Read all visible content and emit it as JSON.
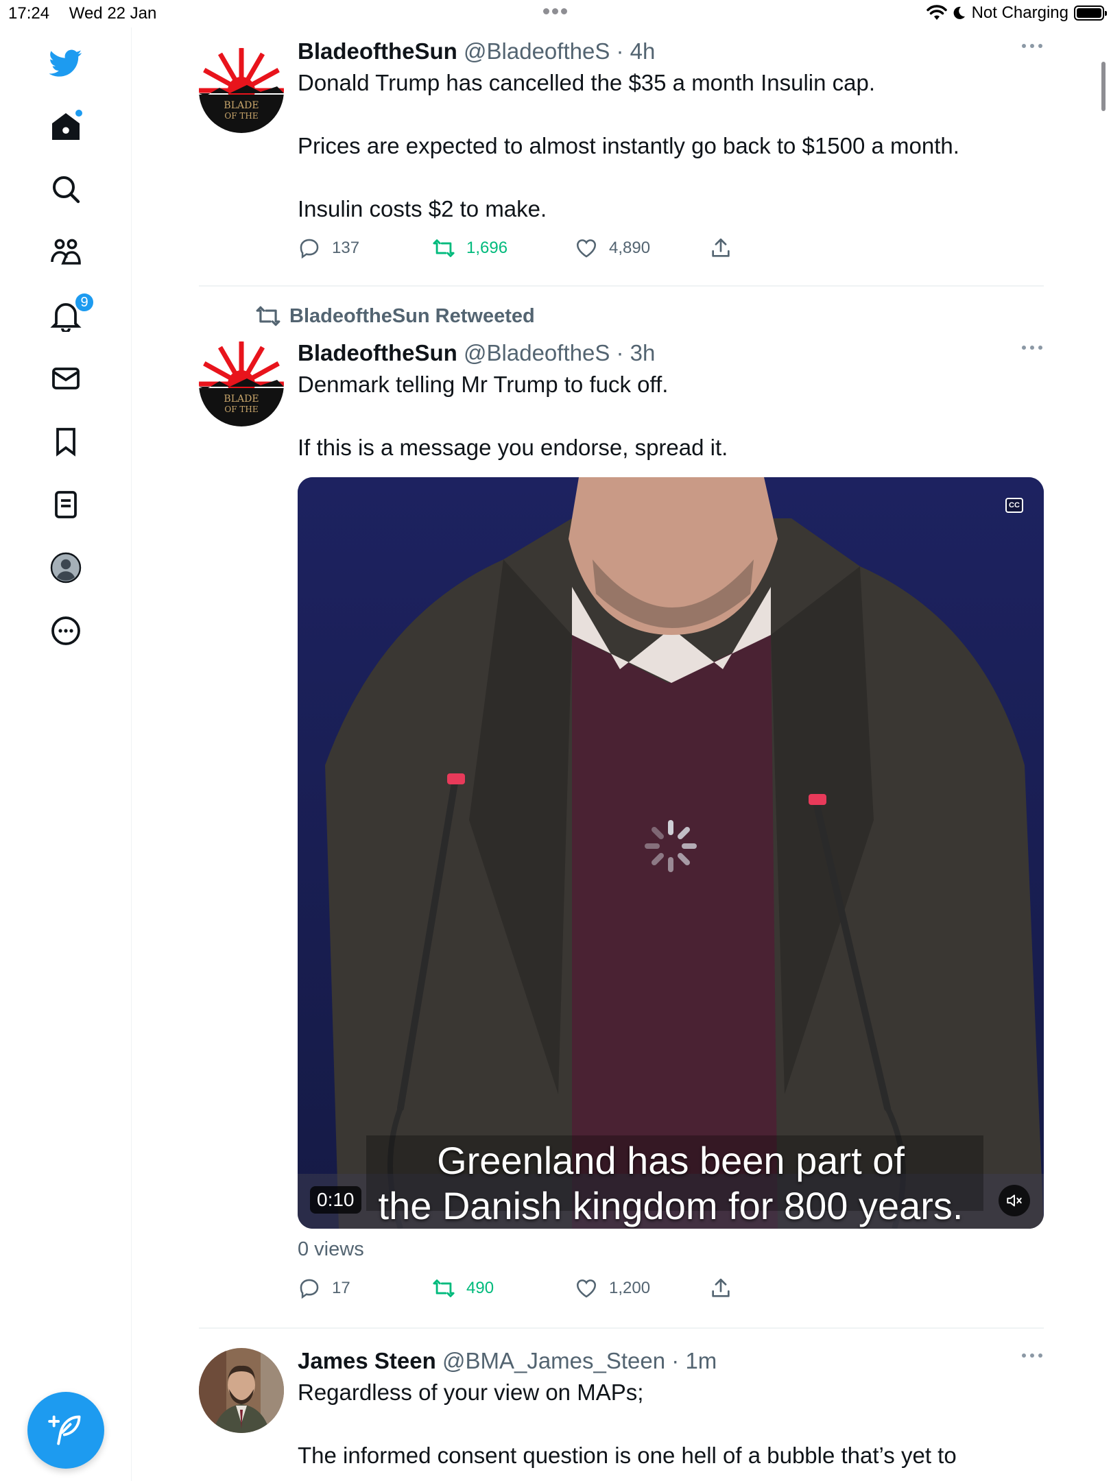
{
  "status_bar": {
    "time": "17:24",
    "date": "Wed 22 Jan",
    "battery_text": "Not Charging"
  },
  "sidebar": {
    "items": [
      {
        "icon": "twitter-logo-icon"
      },
      {
        "icon": "home-icon",
        "has_dot": true
      },
      {
        "icon": "search-icon"
      },
      {
        "icon": "communities-icon"
      },
      {
        "icon": "bell-icon",
        "badge": "9"
      },
      {
        "icon": "mail-icon"
      },
      {
        "icon": "bookmark-icon"
      },
      {
        "icon": "lists-icon"
      },
      {
        "icon": "profile-icon"
      },
      {
        "icon": "more-circle-icon"
      }
    ],
    "compose_icon": "feather-plus-icon"
  },
  "tweets": [
    {
      "name": "BladeoftheSun",
      "meta": "@BladeoftheS · 4h",
      "text": [
        "Donald Trump has cancelled the $35 a month Insulin cap.",
        "Prices are expected to almost instantly go back to $1500 a month.",
        "Insulin costs $2 to make."
      ],
      "replies": "137",
      "retweets": "1,696",
      "likes": "4,890"
    },
    {
      "retweeted_by": "BladeoftheSun Retweeted",
      "name": "BladeoftheSun",
      "meta": "@BladeoftheS · 3h",
      "text": [
        "Denmark telling Mr Trump to fuck off.",
        "If this is a message you endorse, spread it."
      ],
      "video": {
        "subtitle_line1": "Greenland has been part of",
        "subtitle_line2": "the Danish kingdom for 800 years.",
        "duration": "0:10",
        "cc": "CC"
      },
      "views": "0 views",
      "replies": "17",
      "retweets": "490",
      "likes": "1,200"
    },
    {
      "name": "James Steen",
      "meta": "@BMA_James_Steen · 1m",
      "text": [
        "Regardless of your view on MAPs;",
        "The informed consent question is one hell of a bubble that’s yet to"
      ]
    }
  ],
  "colors": {
    "accent": "#1d9bf0",
    "retweet_green": "#00ba7c",
    "secondary_text": "#536471"
  }
}
